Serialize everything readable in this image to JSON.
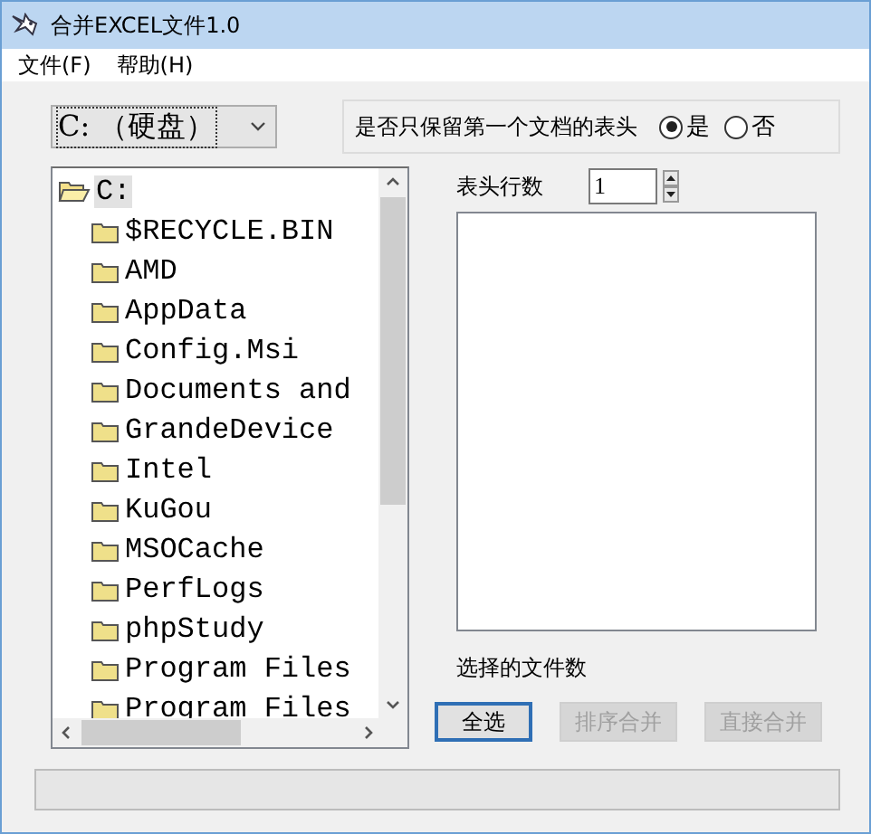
{
  "window": {
    "title": "合并EXCEL文件1.0"
  },
  "menu": [
    "文件(F)",
    "帮助(H)"
  ],
  "drive_select": {
    "value": "C: （硬盘）"
  },
  "header_option": {
    "label": "是否只保留第一个文档的表头",
    "options": [
      {
        "label": "是",
        "selected": true
      },
      {
        "label": "否",
        "selected": false
      }
    ]
  },
  "tree": {
    "label": "C:",
    "expanded": true,
    "selected": true,
    "children": [
      {
        "label": "$RECYCLE.BIN",
        "selected": false
      },
      {
        "label": "AMD",
        "selected": false
      },
      {
        "label": "AppData",
        "selected": false
      },
      {
        "label": "Config.Msi",
        "selected": false
      },
      {
        "label": "Documents and",
        "selected": false
      },
      {
        "label": "GrandeDevice",
        "selected": false
      },
      {
        "label": "Intel",
        "selected": false
      },
      {
        "label": "KuGou",
        "selected": false
      },
      {
        "label": "MSOCache",
        "selected": false
      },
      {
        "label": "PerfLogs",
        "selected": false
      },
      {
        "label": "phpStudy",
        "selected": false
      },
      {
        "label": "Program Files",
        "selected": false
      },
      {
        "label": "Program Files",
        "selected": false
      }
    ]
  },
  "header_rows": {
    "label": "表头行数",
    "value": "1"
  },
  "selected_files_label": "选择的文件数",
  "buttons": [
    {
      "label": "全选",
      "disabled": false,
      "focused": true
    },
    {
      "label": "排序合并",
      "disabled": true,
      "focused": false
    },
    {
      "label": "直接合并",
      "disabled": true,
      "focused": false
    }
  ]
}
